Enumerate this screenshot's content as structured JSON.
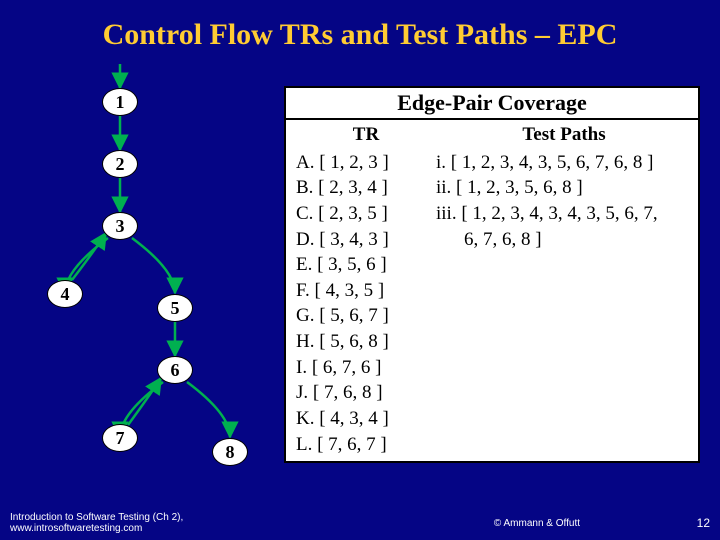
{
  "title": "Control Flow TRs and Test Paths – EPC",
  "panel_title": "Edge-Pair Coverage",
  "tr_header": "TR",
  "tp_header": "Test Paths",
  "tr": {
    "A": "A. [ 1, 2, 3 ]",
    "B": "B. [ 2, 3, 4 ]",
    "C": "C. [ 2, 3, 5 ]",
    "D": "D. [ 3, 4, 3 ]",
    "E": "E. [ 3, 5, 6 ]",
    "F": "F. [ 4, 3, 5 ]",
    "G": "G. [ 5, 6, 7 ]",
    "H": "H. [ 5, 6, 8 ]",
    "I": "I. [ 6, 7, 6 ]",
    "J": "J. [ 7, 6, 8 ]",
    "K": "K. [ 4, 3, 4 ]",
    "L": "L. [ 7, 6, 7 ]"
  },
  "tp": {
    "i": "i. [ 1, 2, 3, 4, 3, 5, 6, 7, 6, 8 ]",
    "ii": "ii. [ 1, 2, 3, 5, 6, 8 ]",
    "iii_a": "iii. [ 1, 2, 3, 4, 3, 4, 3, 5, 6, 7,",
    "iii_b": "6, 7, 6, 8 ]"
  },
  "nodes": {
    "n1": "1",
    "n2": "2",
    "n3": "3",
    "n4": "4",
    "n5": "5",
    "n6": "6",
    "n7": "7",
    "n8": "8"
  },
  "footer": {
    "left": "Introduction to Software Testing (Ch 2), www.introsoftwaretesting.com",
    "center": "© Ammann & Offutt",
    "right": "12"
  }
}
